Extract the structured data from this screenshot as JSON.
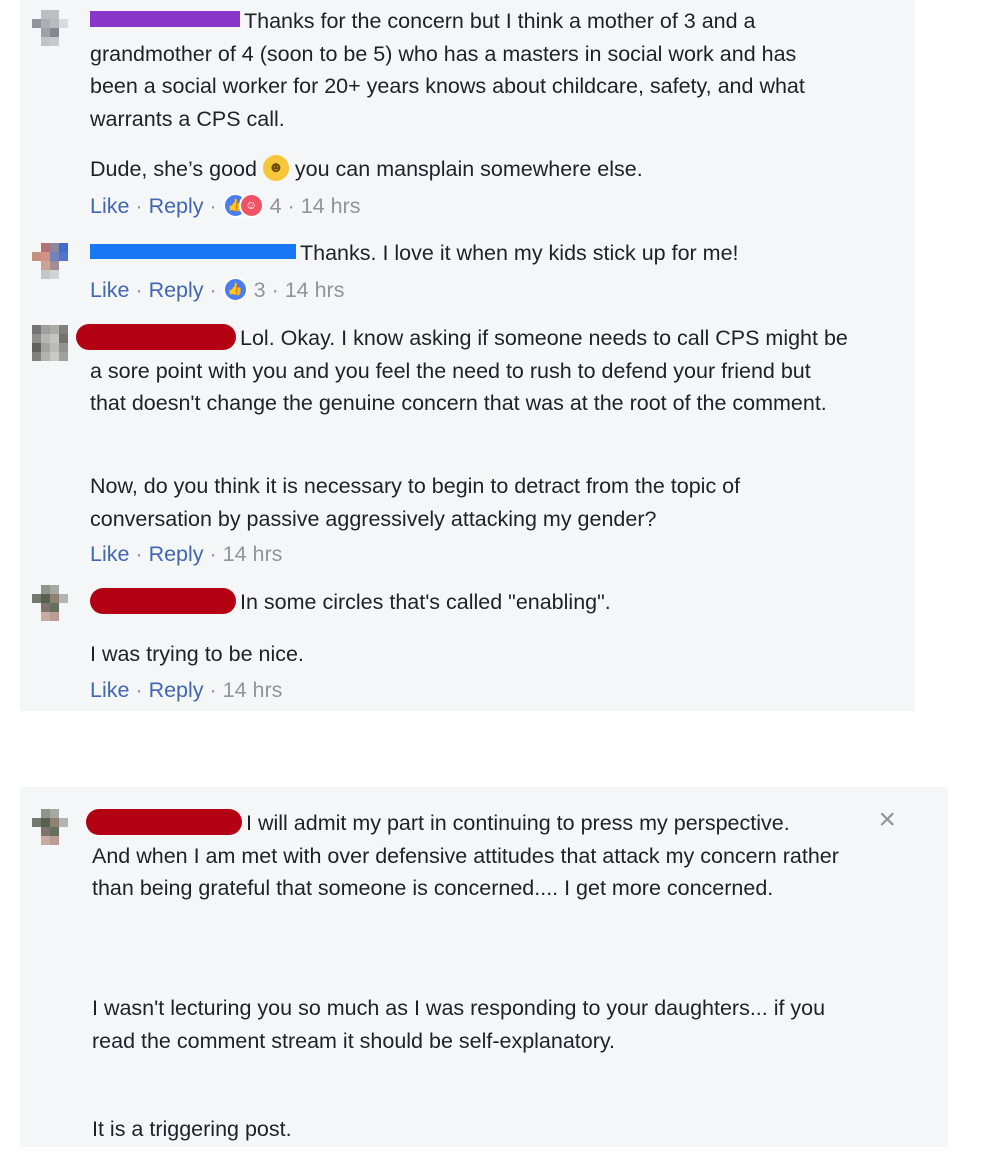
{
  "colors": {
    "panel_bg": "#f5f6f7",
    "link": "#4267b2",
    "meta": "#90949c",
    "redact_purple": "#8a35c9",
    "redact_blue": "#1877f2",
    "redact_red": "#b30013"
  },
  "comments": [
    {
      "redaction": "purple",
      "paragraphs": [
        "Thanks for the concern but I think a mother of 3 and a grandmother of 4 (soon to be 5) who has a masters in social work and has been a social worker for 20+ years knows about childcare, safety, and what warrants a CPS call.",
        "Dude, she’s good",
        "you can mansplain somewhere else."
      ],
      "like": "Like",
      "reply": "Reply",
      "reactions": [
        "like-icon",
        "haha-icon"
      ],
      "reaction_count": "4",
      "time": "14 hrs"
    },
    {
      "redaction": "blue",
      "paragraphs": [
        "Thanks. I love it when my kids stick up for me!"
      ],
      "like": "Like",
      "reply": "Reply",
      "reactions": [
        "like-icon"
      ],
      "reaction_count": "3",
      "time": "14 hrs"
    },
    {
      "redaction": "red",
      "paragraphs": [
        "Lol. Okay. I know asking if someone needs to call CPS might be a sore point with you and you feel the need to rush to defend your friend but that doesn't change the genuine concern that was at the root of the comment.",
        "Now, do you think it is necessary to begin to detract from the topic of conversation by passive aggressively attacking my gender?"
      ],
      "like": "Like",
      "reply": "Reply",
      "time": "14 hrs"
    },
    {
      "redaction": "red",
      "paragraphs": [
        "In some circles that's called \"enabling\".",
        "I was trying to be nice."
      ],
      "like": "Like",
      "reply": "Reply",
      "time": "14 hrs"
    },
    {
      "redaction": "red",
      "paragraphs": [
        "I will admit my part in continuing to press my perspective.",
        "And when I am met with over defensive attitudes that attack my concern rather than being grateful that someone is concerned.... I get more concerned.",
        "I wasn't lecturing you so much as I was responding to your daughters... if you read the comment stream it should be self-explanatory.",
        "It is a triggering post."
      ]
    }
  ],
  "close_icon": "×",
  "separator": " · ",
  "emoji_icon": "laughing-emoji-icon"
}
